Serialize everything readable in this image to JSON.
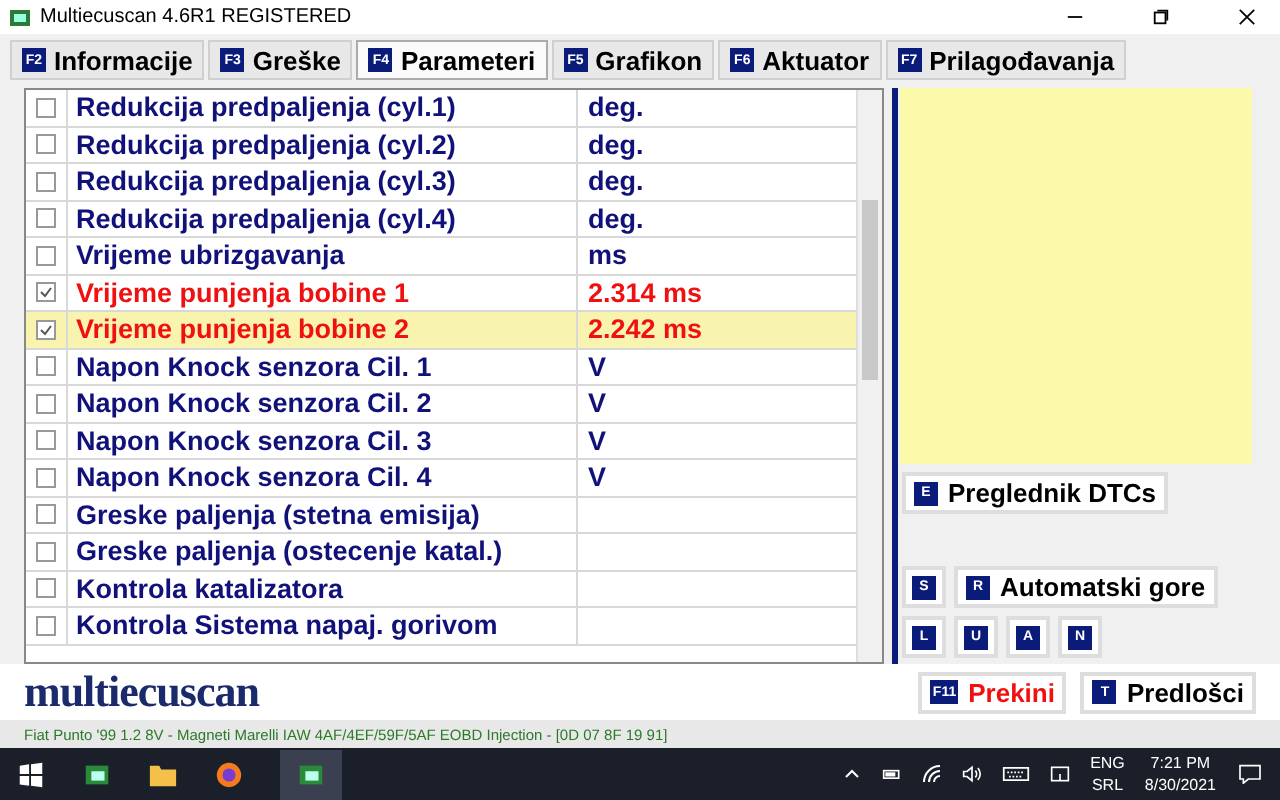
{
  "window": {
    "title": "Multiecuscan 4.6R1 REGISTERED"
  },
  "tabs": [
    {
      "key": "F2",
      "label": "Informacije",
      "selected": false
    },
    {
      "key": "F3",
      "label": "Greške",
      "selected": false
    },
    {
      "key": "F4",
      "label": "Parameteri",
      "selected": true
    },
    {
      "key": "F5",
      "label": "Grafikon",
      "selected": false
    },
    {
      "key": "F6",
      "label": "Aktuator",
      "selected": false
    },
    {
      "key": "F7",
      "label": "Prilagođavanja",
      "selected": false
    }
  ],
  "parameters": [
    {
      "name": "Redukcija predpaljenja (cyl.1)",
      "value": "deg.",
      "checked": false,
      "selected": false
    },
    {
      "name": "Redukcija predpaljenja (cyl.2)",
      "value": "deg.",
      "checked": false,
      "selected": false
    },
    {
      "name": "Redukcija predpaljenja (cyl.3)",
      "value": "deg.",
      "checked": false,
      "selected": false
    },
    {
      "name": "Redukcija predpaljenja (cyl.4)",
      "value": "deg.",
      "checked": false,
      "selected": false
    },
    {
      "name": "Vrijeme ubrizgavanja",
      "value": "ms",
      "checked": false,
      "selected": false
    },
    {
      "name": "Vrijeme punjenja bobine 1",
      "value": "2.314 ms",
      "checked": true,
      "selected": false
    },
    {
      "name": "Vrijeme punjenja bobine 2",
      "value": "2.242 ms",
      "checked": true,
      "selected": true
    },
    {
      "name": "Napon Knock senzora Cil. 1",
      "value": "V",
      "checked": false,
      "selected": false
    },
    {
      "name": "Napon Knock senzora Cil. 2",
      "value": "V",
      "checked": false,
      "selected": false
    },
    {
      "name": "Napon Knock senzora Cil. 3",
      "value": "V",
      "checked": false,
      "selected": false
    },
    {
      "name": "Napon Knock senzora Cil. 4",
      "value": "V",
      "checked": false,
      "selected": false
    },
    {
      "name": "Greske paljenja (stetna emisija)",
      "checked": false,
      "selected": false
    },
    {
      "name": "Greske paljenja (ostecenje katal.)",
      "checked": false,
      "selected": false
    },
    {
      "name": "Kontrola katalizatora",
      "checked": false,
      "selected": false
    },
    {
      "name": "Kontrola Sistema napaj. gorivom",
      "checked": false,
      "selected": false
    }
  ],
  "side_buttons": {
    "dtc": {
      "key": "E",
      "label": "Preglednik DTCs"
    },
    "s": {
      "key": "S"
    },
    "auto": {
      "key": "R",
      "label": "Automatski gore"
    },
    "small": [
      {
        "key": "L"
      },
      {
        "key": "U"
      },
      {
        "key": "A"
      },
      {
        "key": "N"
      }
    ]
  },
  "logo": "multiecuscan",
  "bottom_buttons": [
    {
      "key": "F11",
      "label": "Prekini",
      "kind": "danger"
    },
    {
      "key": "T",
      "label": "Predlošci",
      "kind": "normal"
    }
  ],
  "status_bar": "Fiat Punto '99 1.2 8V - Magneti Marelli IAW 4AF/4EF/59F/5AF EOBD Injection - [0D 07 8F 19 91]",
  "taskbar": {
    "language": [
      "ENG",
      "SRL"
    ],
    "time": "7:21 PM",
    "date": "8/30/2021"
  }
}
